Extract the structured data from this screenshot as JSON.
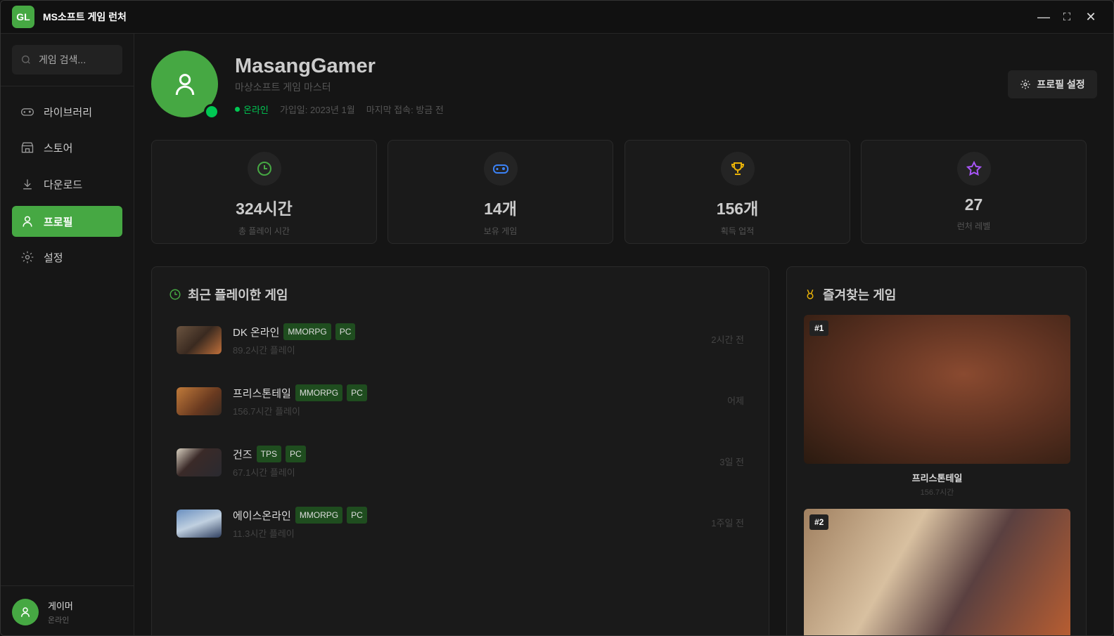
{
  "app": {
    "logo": "GL",
    "title": "MS소프트 게임 런처"
  },
  "window_controls": {
    "minimize": "—",
    "maximize": "⛶",
    "close": "✕"
  },
  "sidebar": {
    "search_placeholder": "게임 검색...",
    "items": [
      {
        "label": "라이브러리",
        "icon": "gamepad-icon"
      },
      {
        "label": "스토어",
        "icon": "store-icon"
      },
      {
        "label": "다운로드",
        "icon": "download-icon"
      },
      {
        "label": "프로필",
        "icon": "user-icon",
        "active": true
      },
      {
        "label": "설정",
        "icon": "gear-icon"
      }
    ],
    "user": {
      "name": "게이머",
      "status": "온라인"
    }
  },
  "profile": {
    "name": "MasangGamer",
    "subtitle": "마상소프트 게임 마스터",
    "status": "온라인",
    "joined": "가입일: 2023년 1월",
    "last_login": "마지막 접속: 방금 전",
    "settings_button": "프로필 설정"
  },
  "stats": [
    {
      "value": "324시간",
      "label": "총 플레이 시간",
      "color": "#46a843"
    },
    {
      "value": "14개",
      "label": "보유 게임",
      "color": "#3b82f6"
    },
    {
      "value": "156개",
      "label": "획득 업적",
      "color": "#eab308"
    },
    {
      "value": "27",
      "label": "런처 레벨",
      "color": "#a855f7"
    }
  ],
  "recent": {
    "title": "최근 플레이한 게임",
    "games": [
      {
        "name": "DK 온라인",
        "tags": [
          "MMORPG",
          "PC"
        ],
        "hours": "89.2시간 플레이",
        "time": "2시간 전"
      },
      {
        "name": "프리스톤테일",
        "tags": [
          "MMORPG",
          "PC"
        ],
        "hours": "156.7시간 플레이",
        "time": "어제"
      },
      {
        "name": "건즈",
        "tags": [
          "TPS",
          "PC"
        ],
        "hours": "67.1시간 플레이",
        "time": "3일 전"
      },
      {
        "name": "에이스온라인",
        "tags": [
          "MMORPG",
          "PC"
        ],
        "hours": "11.3시간 플레이",
        "time": "1주일 전"
      }
    ]
  },
  "favorites": {
    "title": "즐겨찾는 게임",
    "items": [
      {
        "rank": "#1",
        "name": "프리스톤테일",
        "hours": "156.7시간"
      },
      {
        "rank": "#2"
      }
    ]
  }
}
